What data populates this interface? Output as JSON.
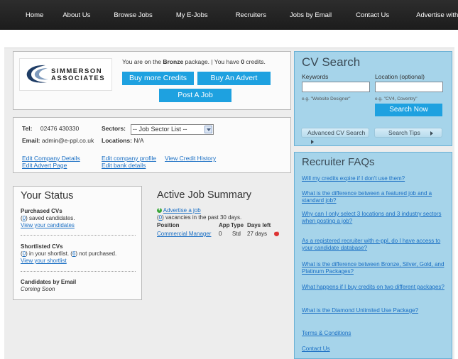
{
  "nav": {
    "items": [
      "Home",
      "About Us",
      "Browse Jobs",
      "My E-Jobs",
      "Recruiters",
      "Jobs by Email",
      "Contact Us",
      "Advertise with Us"
    ]
  },
  "logo": {
    "line1": "SIMMERSON",
    "line2": "ASSOCIATES"
  },
  "package": {
    "prefix": "You are on the ",
    "name": "Bronze",
    "middle": " package. | You have ",
    "credits": "0",
    "suffix": " credits."
  },
  "buttons": {
    "buy_credits": "Buy more Credits",
    "buy_advert": "Buy An Advert",
    "post_job": "Post A Job"
  },
  "company": {
    "tel_label": "Tel:",
    "tel_value": "02476 430330",
    "email_label": "Email:",
    "email_value": "admin@e-ppl.co.uk",
    "sectors_label": "Sectors:",
    "sectors_select": "-- Job Sector List --",
    "locations_label": "Locations:",
    "locations_value": "N/A",
    "links": {
      "edit_details": "Edit Company Details",
      "edit_advert": "Edit Advert Page",
      "edit_profile": "Edit company profile",
      "edit_bank": "Edit bank details",
      "view_credit": "View Credit History"
    }
  },
  "status": {
    "title": "Your Status",
    "purchased_label": "Purchased CVs",
    "purchased_count": "0",
    "purchased_text": " saved candidates.",
    "view_candidates": "View your candidates",
    "shortlisted_label": "Shortlisted CVs",
    "shortlisted_count": "0",
    "shortlisted_mid": " in your shortlist. ",
    "not_purchased_count": "6",
    "not_purchased_text": " not purchased.",
    "view_shortlist": "View your shortlist",
    "email_label": "Candidates by Email",
    "email_value": "Coming Soon"
  },
  "ajs": {
    "title": "Active Job Summary",
    "advertise": "Advertise a job",
    "vacancy_count": "0",
    "vacancy_text": " vacancies in the past 30 days.",
    "headers": [
      "Position",
      "App",
      "Type",
      "Days left"
    ],
    "rows": [
      {
        "position": "Commercial Manager",
        "app": "0",
        "type": "Std",
        "days": "27 days"
      }
    ]
  },
  "cv": {
    "title": "CV Search",
    "keywords_label": "Keywords",
    "location_label": "Location (optional)",
    "keywords_hint": "e.g. \"Website Designer\"",
    "location_hint": "e.g. \"CV4, Coventry\"",
    "search_button": "Search Now",
    "advanced": "Advanced CV Search",
    "tips": "Search Tips"
  },
  "faq": {
    "title": "Recruiter FAQs",
    "items": [
      "Will my credits expire if I don't use them?",
      "What is the difference between a featured job and a standard job?",
      "Why can I only select 3 locations and 3 industry sectors when posting a job?",
      "As a registered recruiter with e-ppl, do I have access to your candidate database?",
      "What is the difference between Bronze, Silver, Gold, and Platinum Packages?",
      "What happens if I buy credits on two different packages?",
      "What is the Diamond Unlimited Use Package?"
    ],
    "terms": "Terms & Conditions",
    "contact": "Contact Us"
  },
  "colors": {
    "accent": "#1ea1e0",
    "panel_blue": "#a6d4ea",
    "nav_bg": "#222222",
    "link": "#1a6fc4"
  }
}
